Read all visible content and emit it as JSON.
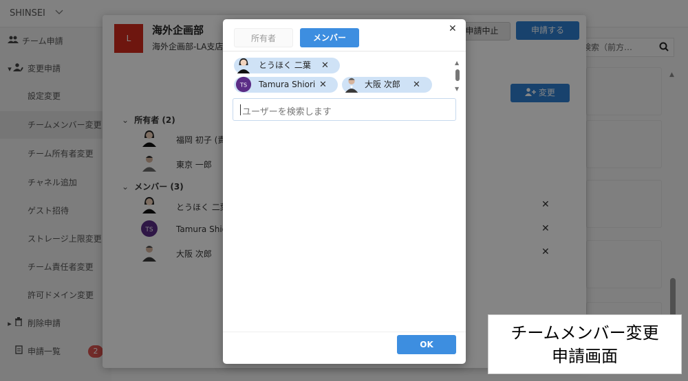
{
  "app": {
    "name": "SHINSEI"
  },
  "sidebar": {
    "items": [
      {
        "label": "チーム申請",
        "icon": "users-icon",
        "level": "top"
      },
      {
        "label": "変更申請",
        "icon": "user-edit-icon",
        "level": "top",
        "expanded": true
      },
      {
        "label": "設定変更",
        "level": "sub"
      },
      {
        "label": "チームメンバー変更",
        "level": "sub",
        "selected": true
      },
      {
        "label": "チーム所有者変更",
        "level": "sub"
      },
      {
        "label": "チャネル追加",
        "level": "sub"
      },
      {
        "label": "ゲスト招待",
        "level": "sub"
      },
      {
        "label": "ストレージ上限変更",
        "level": "sub"
      },
      {
        "label": "チーム責任者変更",
        "level": "sub"
      },
      {
        "label": "許可ドメイン変更",
        "level": "sub"
      },
      {
        "label": "削除申請",
        "icon": "trash-icon",
        "level": "top"
      },
      {
        "label": "申請一覧",
        "icon": "document-icon",
        "level": "top",
        "badge": "2"
      }
    ]
  },
  "background": {
    "search_text": "検索（前方…"
  },
  "outer_dialog": {
    "org_icon_letter": "L",
    "org_name": "海外企画部",
    "org_sub": "海外企画部-LA支店",
    "cancel_request_label": "申請中止",
    "apply_label": "申請する",
    "change_label": "変更",
    "owners": {
      "header": "所有者 (2)",
      "rows": [
        {
          "name": "福岡 初子 (責"
        },
        {
          "name": "東京 一郎"
        }
      ]
    },
    "members": {
      "header": "メンバー (3)",
      "rows": [
        {
          "name": "とうほく 二葉",
          "remove": "✕"
        },
        {
          "name": "Tamura Shiori",
          "initials": "TS",
          "remove": "✕"
        },
        {
          "name": "大阪 次郎",
          "remove": "✕"
        }
      ]
    }
  },
  "member_dialog": {
    "tabs": [
      {
        "label": "所有者",
        "active": false
      },
      {
        "label": "メンバー",
        "active": true
      }
    ],
    "close_glyph": "✕",
    "chips": [
      {
        "label": "とうほく 二葉",
        "remove": "✕"
      },
      {
        "label": "Tamura Shiori",
        "initials": "TS",
        "remove": "✕"
      },
      {
        "label": "大阪 次郎",
        "remove": "✕"
      }
    ],
    "search_placeholder": "ユーザーを検索します",
    "ok_label": "OK"
  },
  "caption": {
    "line1": "チームメンバー変更",
    "line2": "申請画面"
  },
  "colors": {
    "primary": "#3d8ee0",
    "chip": "#cfe2f6",
    "org_red": "#d42b1e",
    "initials_purple": "#5b2d86"
  }
}
